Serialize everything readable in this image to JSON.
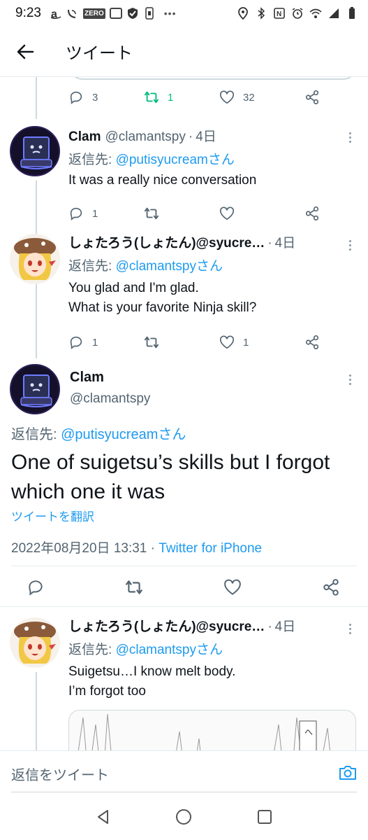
{
  "status_bar": {
    "time": "9:23",
    "icons": [
      "amazon-icon",
      "wifi-calling-icon",
      "zero-icon",
      "app-icon",
      "shield-icon",
      "sim-icon",
      "more-dots-icon",
      "location-icon",
      "bluetooth-icon",
      "nfc-icon",
      "alarm-icon",
      "wifi-icon",
      "signal-icon",
      "battery-icon"
    ],
    "zero_label": "ZERO"
  },
  "header": {
    "title": "ツイート"
  },
  "prev_tweet": {
    "reply_count": "3",
    "retweet_count": "1",
    "like_count": "32"
  },
  "tweets": [
    {
      "name": "Clam",
      "handle": "@clamantspy",
      "dot": "·",
      "time": "4日",
      "reply_prefix": "返信先: ",
      "reply_to": "@putisyucreamさん",
      "text": [
        "It was a really nice conversation"
      ],
      "reply_count": "1",
      "retweet_count": "",
      "like_count": ""
    },
    {
      "name": "しょたろう(しょたん)@syucre…",
      "handle": "",
      "dot": "·",
      "time": "4日",
      "reply_prefix": "返信先: ",
      "reply_to": "@clamantspyさん",
      "text": [
        "You glad and I'm glad.",
        "What is your favorite Ninja skill?"
      ],
      "reply_count": "1",
      "retweet_count": "",
      "like_count": "1"
    }
  ],
  "main_tweet": {
    "name": "Clam",
    "handle": "@clamantspy",
    "reply_prefix": "返信先: ",
    "reply_to": "@putisyucreamさん",
    "text": "One of suigetsu’s skills but I forgot which one it was",
    "translate": "ツイートを翻訳",
    "datetime": "2022年08月20日 13:31",
    "sep": " · ",
    "source": "Twitter for iPhone"
  },
  "next_tweet": {
    "name": "しょたろう(しょたん)@syucre…",
    "dot": "·",
    "time": "4日",
    "reply_prefix": "返信先: ",
    "reply_to": "@clamantspyさん",
    "text": [
      "Suigetsu…I know melt body.",
      "I’m forgot too"
    ]
  },
  "reply_bar": {
    "placeholder": "返信をツイート"
  },
  "colors": {
    "accent": "#1d9bf0",
    "retweet_green": "#00ba7c",
    "text": "#0f1419",
    "secondary": "#536471"
  }
}
